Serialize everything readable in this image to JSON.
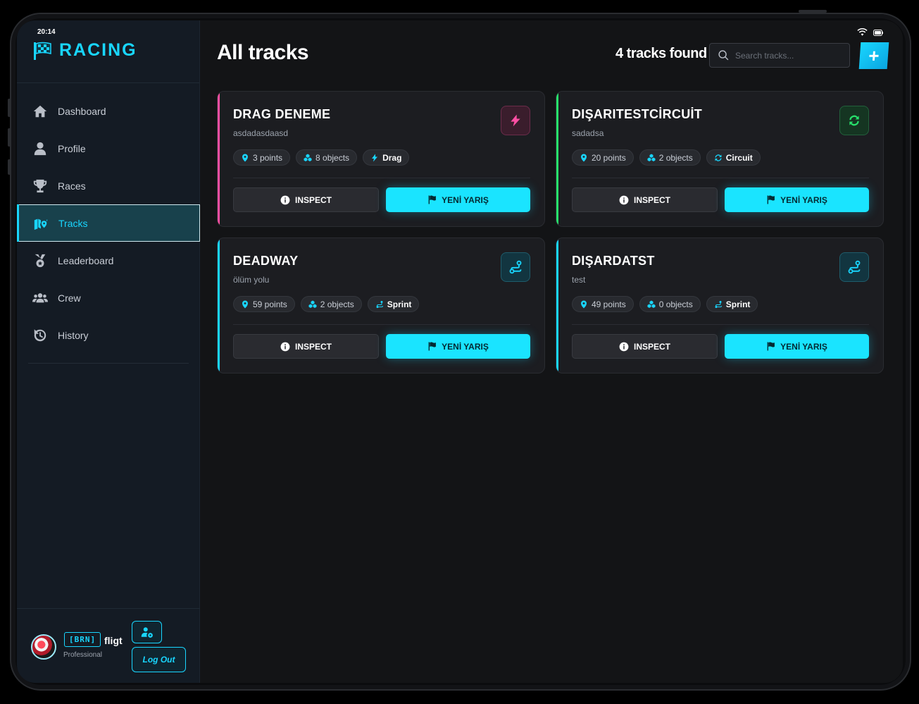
{
  "status": {
    "time": "20:14"
  },
  "brand": {
    "name": "RACING"
  },
  "sidebar": {
    "items": [
      {
        "label": "Dashboard",
        "icon": "home-icon",
        "active": false
      },
      {
        "label": "Profile",
        "icon": "user-icon",
        "active": false
      },
      {
        "label": "Races",
        "icon": "trophy-icon",
        "active": false
      },
      {
        "label": "Tracks",
        "icon": "map-location-icon",
        "active": true
      },
      {
        "label": "Leaderboard",
        "icon": "medal-icon",
        "active": false
      },
      {
        "label": "Crew",
        "icon": "users-icon",
        "active": false
      },
      {
        "label": "History",
        "icon": "history-icon",
        "active": false
      }
    ]
  },
  "profile": {
    "tag": "[BRN]",
    "username": "fligt",
    "rank": "Professional",
    "logout_label": "Log Out"
  },
  "main": {
    "title": "All tracks",
    "count_text": "4 tracks found",
    "search_placeholder": "Search tracks...",
    "add_label": "+"
  },
  "tracks": [
    {
      "name": "DRAG DENEME",
      "description": "asdadasdaasd",
      "points": "3 points",
      "objects": "8 objects",
      "type": "Drag",
      "accent": "#ff4fa3",
      "type_icon": "bolt-icon",
      "inspect_label": "INSPECT",
      "race_label": "YENİ YARIŞ"
    },
    {
      "name": "DIŞARITESTCİRCUİT",
      "description": "sadadsa",
      "points": "20 points",
      "objects": "2 objects",
      "type": "Circuit",
      "accent": "#27e06b",
      "type_icon": "sync-icon",
      "inspect_label": "INSPECT",
      "race_label": "YENİ YARIŞ"
    },
    {
      "name": "DEADWAY",
      "description": "ölüm yolu",
      "points": "59 points",
      "objects": "2 objects",
      "type": "Sprint",
      "accent": "#19d6ff",
      "type_icon": "route-icon",
      "inspect_label": "INSPECT",
      "race_label": "YENİ YARIŞ"
    },
    {
      "name": "DIŞARDATST",
      "description": "test",
      "points": "49 points",
      "objects": "0 objects",
      "type": "Sprint",
      "accent": "#19d6ff",
      "type_icon": "route-icon",
      "inspect_label": "INSPECT",
      "race_label": "YENİ YARIŞ"
    }
  ],
  "colors": {
    "accent": "#19d6ff",
    "background": "#131416",
    "sidebar": "#141b24"
  }
}
